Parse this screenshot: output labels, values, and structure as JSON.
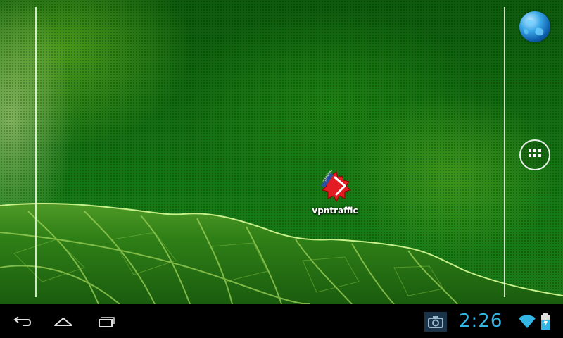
{
  "home": {
    "shortcut": {
      "label": "vpntraffic",
      "icon": "vpntraffic-app-icon",
      "icon_caption": "vpntraffic"
    },
    "search_icon": "globe-search-icon",
    "apps_icon": "all-apps-grid-icon"
  },
  "navbar": {
    "back_icon": "back-arrow-icon",
    "home_icon": "home-icon",
    "recents_icon": "recent-apps-icon"
  },
  "status": {
    "time": "2:26",
    "screenshot_icon": "camera-icon",
    "wifi_icon": "wifi-signal-icon",
    "battery_icon": "battery-charging-icon",
    "accent_color": "#33b5e5"
  }
}
